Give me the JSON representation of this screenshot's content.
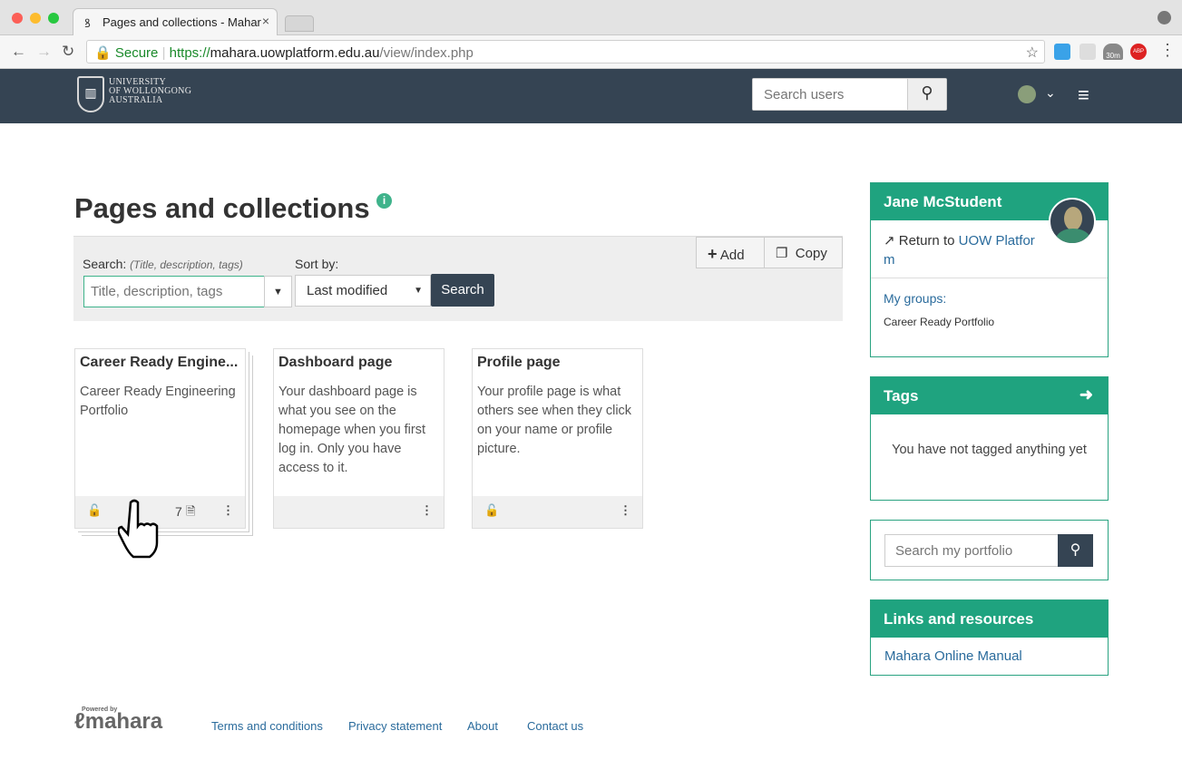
{
  "browser": {
    "tab_title": "Pages and collections - Mahar",
    "secure_label": "Secure",
    "url_scheme": "https://",
    "url_host": "mahara.uowplatform.edu.au",
    "url_path": "/view/index.php",
    "ext_badge": "30m",
    "abp_badge": "ABP"
  },
  "header": {
    "logo_line1": "UNIVERSITY",
    "logo_line2": "OF WOLLONGONG",
    "logo_line3": "AUSTRALIA",
    "search_placeholder": "Search users"
  },
  "page": {
    "title": "Pages and collections",
    "search_label": "Search:",
    "search_hint": "(Title, description, tags)",
    "search_placeholder": "Title, description, tags",
    "sort_label": "Sort by:",
    "sort_value": "Last modified",
    "search_button": "Search",
    "add_button": "Add",
    "copy_button": "Copy"
  },
  "cards": [
    {
      "title": "Career Ready Engine...",
      "description": "Career Ready Engineering Portfolio",
      "count": "7"
    },
    {
      "title": "Dashboard page",
      "description": "Your dashboard page is what you see on the homepage when you first log in. Only you have access to it."
    },
    {
      "title": "Profile page",
      "description": "Your profile page is what others see when they click on your name or profile picture."
    }
  ],
  "sidebar": {
    "user_name": "Jane McStudent",
    "return_prefix": "Return to",
    "return_link_line1": "UOW Platfor",
    "return_link_line2": "m",
    "groups_label": "My groups:",
    "group_item": "Career Ready Portfolio",
    "tags_title": "Tags",
    "tags_empty": "You have not tagged anything yet",
    "portfolio_search_placeholder": "Search my portfolio",
    "links_title": "Links and resources",
    "links_item": "Mahara Online Manual"
  },
  "footer": {
    "powered_by": "Powered by",
    "brand": "mahara",
    "links": [
      "Terms and conditions",
      "Privacy statement",
      "About",
      "Contact us"
    ]
  },
  "colors": {
    "header_bg": "#354453",
    "accent_green": "#1fa37f",
    "link_blue": "#2a6b9c"
  }
}
